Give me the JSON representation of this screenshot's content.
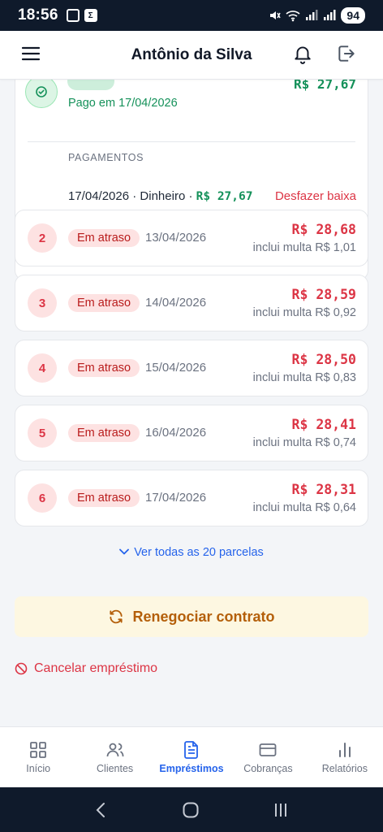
{
  "status_bar": {
    "time": "18:56",
    "battery": "94"
  },
  "header": {
    "title": "Antônio da Silva"
  },
  "paid_installment": {
    "paid_date_text": "Pago em 17/04/2026",
    "amount": "R$ 27,67",
    "payments_label": "PAGAMENTOS",
    "payment": {
      "date": "17/04/2026",
      "method": "Dinheiro",
      "amount": "R$ 27,67"
    },
    "undo_label": "Desfazer baixa"
  },
  "installments": [
    {
      "number": "2",
      "status": "Em atraso",
      "due_date": "13/04/2026",
      "amount": "R$ 28,68",
      "fine": "inclui multa R$ 1,01"
    },
    {
      "number": "3",
      "status": "Em atraso",
      "due_date": "14/04/2026",
      "amount": "R$ 28,59",
      "fine": "inclui multa R$ 0,92"
    },
    {
      "number": "4",
      "status": "Em atraso",
      "due_date": "15/04/2026",
      "amount": "R$ 28,50",
      "fine": "inclui multa R$ 0,83"
    },
    {
      "number": "5",
      "status": "Em atraso",
      "due_date": "16/04/2026",
      "amount": "R$ 28,41",
      "fine": "inclui multa R$ 0,74"
    },
    {
      "number": "6",
      "status": "Em atraso",
      "due_date": "17/04/2026",
      "amount": "R$ 28,31",
      "fine": "inclui multa R$ 0,64"
    }
  ],
  "see_all_label": "Ver todas as 20 parcelas",
  "renegotiate_label": "Renegociar contrato",
  "cancel_label": "Cancelar empréstimo",
  "bottom_nav": [
    {
      "label": "Início",
      "icon": "grid-icon",
      "active": false
    },
    {
      "label": "Clientes",
      "icon": "users-icon",
      "active": false
    },
    {
      "label": "Empréstimos",
      "icon": "document-icon",
      "active": true
    },
    {
      "label": "Cobranças",
      "icon": "credit-card-icon",
      "active": false
    },
    {
      "label": "Relatórios",
      "icon": "bar-chart-icon",
      "active": false
    }
  ],
  "colors": {
    "accent": "#2563eb",
    "success": "#15915a",
    "danger": "#dc3545",
    "warning": "#b45f0a"
  }
}
